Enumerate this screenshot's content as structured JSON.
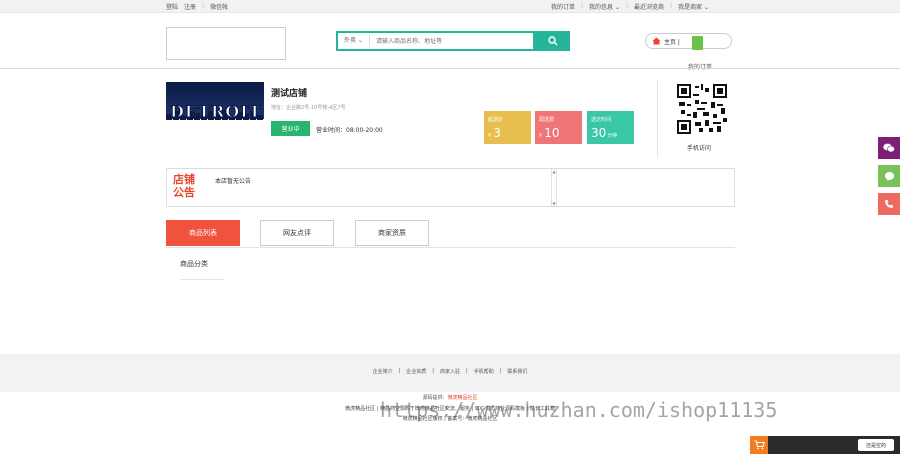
{
  "topbar": {
    "left": [
      "登陆",
      "注册",
      "|",
      "微信帐"
    ],
    "right": [
      "我的订单",
      "|",
      "我的信息 ⌄",
      "|",
      "最近浏览商",
      "|",
      "我是商家 ⌄"
    ]
  },
  "search": {
    "category": "外卖 ⌄",
    "placeholder": "请输入商品名称、地址等"
  },
  "header": {
    "home_label": "主页 |",
    "order_label": "我的订单"
  },
  "store": {
    "image_word": "DETROIT",
    "name": "测试店铺",
    "address": "地址：企业路2号-10号楼-4区7号",
    "open_label": "营业中",
    "hours": "营业时间：08:00-20:00",
    "stats": [
      {
        "label": "起送价",
        "prefix": "¥",
        "value": "3",
        "unit": "",
        "color": "#e8bf4f"
      },
      {
        "label": "配送费",
        "prefix": "¥",
        "value": "10",
        "unit": "",
        "color": "#f07576"
      },
      {
        "label": "送达时间",
        "prefix": "",
        "value": "30",
        "unit": "分钟",
        "color": "#39c7a5"
      }
    ],
    "qr_label": "手机访问"
  },
  "notice": {
    "badge": "店铺公告",
    "text": "本店暂无公告"
  },
  "tabs": [
    {
      "label": "商品列表",
      "active": true
    },
    {
      "label": "网友点评",
      "active": false
    },
    {
      "label": "商家资质",
      "active": false
    }
  ],
  "category_label": "商品分类",
  "footer": {
    "links": [
      "企业简介",
      "|",
      "企业资质",
      "|",
      "商家入驻",
      "|",
      "手机帮助",
      "|",
      "联系我们"
    ],
    "credit_prefix": "源码提供：",
    "credit_name": "微虎精品社区",
    "copy1": "微虎精品社区 | 精品商业源码 | 微虎精品社区交流、服务 | 90G优质商业源码模板 | 站长工具箱",
    "copy2": "微虎精品社区版权 | 备案号：微虎精品社区"
  },
  "watermark": "https://www.huzhan.com/ishop11135",
  "cart": {
    "tip": "还是空的"
  },
  "side_buttons": [
    {
      "icon": "wechat-icon",
      "color": "#7d1f77"
    },
    {
      "icon": "chat-icon",
      "color": "#7ac15a"
    },
    {
      "icon": "phone-icon",
      "color": "#ef6a5e"
    }
  ]
}
